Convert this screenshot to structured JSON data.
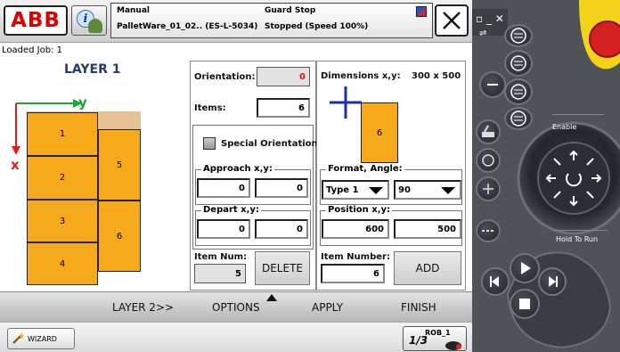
{
  "header": {
    "logo_text": "ABB",
    "mode": "Manual",
    "program": "PalletWare_01_02.. (ES-L-5034)",
    "guard": "Guard Stop",
    "state": "Stopped (Speed 100%)"
  },
  "loaded_job": "Loaded Job: 1",
  "layer": {
    "title": "LAYER 1",
    "axis_x": "x",
    "axis_y": "y",
    "boxes": [
      "1",
      "2",
      "3",
      "4",
      "5",
      "6"
    ]
  },
  "orientation": {
    "label": "Orientation:",
    "value": "0",
    "value_color": "#e01010"
  },
  "items": {
    "label": "Items:",
    "value": "6"
  },
  "special_orientation": {
    "label": "Special Orientation",
    "checked": false
  },
  "approach": {
    "label": "Approach x,y:",
    "x": "0",
    "y": "0"
  },
  "depart": {
    "label": "Depart x,y:",
    "x": "0",
    "y": "0"
  },
  "item_num": {
    "label": "Item Num:",
    "value": "5"
  },
  "delete_label": "DELETE",
  "dimensions": {
    "label": "Dimensions x,y:",
    "value": "300 x 500",
    "preview_number": "6"
  },
  "format_angle": {
    "label": "Format, Angle:",
    "format": "Type 1",
    "angle": "90"
  },
  "position": {
    "label": "Position x,y:",
    "x": "600",
    "y": "500"
  },
  "item_number": {
    "label": "Item Number:",
    "value": "6"
  },
  "add_label": "ADD",
  "nav": {
    "layer2": "LAYER 2>>",
    "options": "OPTIONS",
    "apply": "APPLY",
    "finish": "FINISH"
  },
  "status": {
    "wizard": "WIZARD",
    "rob": "ROB_1",
    "rob_sub": "1/3"
  },
  "pendant": {
    "enable": "Enable",
    "hold_to_run": "Hold To Run"
  },
  "colors": {
    "box": "#f5a91b",
    "pallet": "#e6c397",
    "title": "#233a73",
    "x_axis": "#e31d1d",
    "y_axis": "#17a838",
    "cross": "#1a2fa8"
  }
}
